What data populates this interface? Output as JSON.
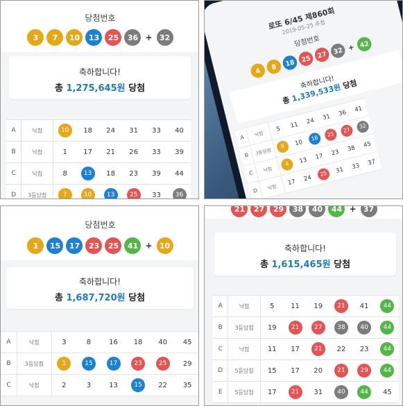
{
  "colors": {
    "yellow": "#e4a818",
    "blue": "#1c80d3",
    "red": "#e55353",
    "gray": "#7c7c7c",
    "green": "#53b746",
    "amount": "#1d7ac8"
  },
  "panel_tl": {
    "title": "당첨번호",
    "balls": [
      {
        "n": "3",
        "c": "yellow"
      },
      {
        "n": "7",
        "c": "yellow"
      },
      {
        "n": "10",
        "c": "yellow"
      },
      {
        "n": "13",
        "c": "blue"
      },
      {
        "n": "25",
        "c": "red"
      },
      {
        "n": "36",
        "c": "gray"
      }
    ],
    "plus": "+",
    "bonus": {
      "n": "32",
      "c": "gray"
    },
    "congrats": "축하합니다!",
    "prize_prefix": "총",
    "prize_amount": "1,275,645원",
    "prize_suffix": "당첨",
    "rows": [
      {
        "letter": "A",
        "rank": "낙첨",
        "nums": [
          {
            "n": "10",
            "c": "yellow"
          },
          {
            "n": "18"
          },
          {
            "n": "24"
          },
          {
            "n": "31"
          },
          {
            "n": "33"
          },
          {
            "n": "40"
          }
        ]
      },
      {
        "letter": "B",
        "rank": "낙첨",
        "nums": [
          {
            "n": "1"
          },
          {
            "n": "17"
          },
          {
            "n": "21"
          },
          {
            "n": "26"
          },
          {
            "n": "33"
          },
          {
            "n": "39"
          }
        ]
      },
      {
        "letter": "C",
        "rank": "낙첨",
        "nums": [
          {
            "n": "8"
          },
          {
            "n": "13",
            "c": "blue"
          },
          {
            "n": "18"
          },
          {
            "n": "23"
          },
          {
            "n": "39"
          },
          {
            "n": "44"
          }
        ]
      },
      {
        "letter": "D",
        "rank": "3등당첨",
        "nums": [
          {
            "n": "7",
            "c": "yellow"
          },
          {
            "n": "10",
            "c": "yellow"
          },
          {
            "n": "13",
            "c": "blue"
          },
          {
            "n": "25",
            "c": "red"
          },
          {
            "n": "33"
          },
          {
            "n": "36",
            "c": "gray"
          }
        ]
      }
    ]
  },
  "panel_tr": {
    "header": "로또 6/45 제860회",
    "date": "2019-05-25 추첨",
    "title": "당첨번호",
    "balls": [
      {
        "n": "4",
        "c": "yellow"
      },
      {
        "n": "8",
        "c": "yellow"
      },
      {
        "n": "18",
        "c": "blue"
      },
      {
        "n": "25",
        "c": "red"
      },
      {
        "n": "27",
        "c": "red"
      },
      {
        "n": "32",
        "c": "gray"
      }
    ],
    "plus": "+",
    "bonus": {
      "n": "42",
      "c": "green"
    },
    "congrats": "축하합니다!",
    "prize_prefix": "총",
    "prize_amount": "1,339,533원",
    "prize_suffix": "당첨",
    "rows": [
      {
        "letter": "A",
        "rank": "낙첨",
        "nums": [
          {
            "n": "5"
          },
          {
            "n": "11"
          },
          {
            "n": "24"
          },
          {
            "n": "31"
          },
          {
            "n": "36"
          },
          {
            "n": "41"
          }
        ]
      },
      {
        "letter": "B",
        "rank": "3등당첨",
        "nums": [
          {
            "n": "8",
            "c": "yellow"
          },
          {
            "n": "10"
          },
          {
            "n": "18",
            "c": "blue"
          },
          {
            "n": "25",
            "c": "red"
          },
          {
            "n": "27",
            "c": "red"
          },
          {
            "n": "32",
            "c": "gray"
          }
        ]
      },
      {
        "letter": "C",
        "rank": "낙첨",
        "nums": [
          {
            "n": "4",
            "c": "yellow"
          },
          {
            "n": "13"
          },
          {
            "n": "17"
          },
          {
            "n": "23"
          },
          {
            "n": "38"
          },
          {
            "n": "45"
          }
        ]
      },
      {
        "letter": "D",
        "rank": "낙첨",
        "nums": [
          {
            "n": "17"
          },
          {
            "n": "24"
          },
          {
            "n": "25",
            "c": "red"
          },
          {
            "n": "31"
          },
          {
            "n": "33"
          },
          {
            "n": "37"
          }
        ]
      }
    ]
  },
  "panel_bl": {
    "title": "당첨번호",
    "balls": [
      {
        "n": "1",
        "c": "yellow"
      },
      {
        "n": "15",
        "c": "blue"
      },
      {
        "n": "17",
        "c": "blue"
      },
      {
        "n": "23",
        "c": "red"
      },
      {
        "n": "25",
        "c": "red"
      },
      {
        "n": "41",
        "c": "green"
      }
    ],
    "plus": "+",
    "bonus": {
      "n": "10",
      "c": "yellow"
    },
    "congrats": "축하합니다!",
    "prize_prefix": "총",
    "prize_amount": "1,687,720원",
    "prize_suffix": "당첨",
    "rows": [
      {
        "letter": "A",
        "rank": "낙첨",
        "nums": [
          {
            "n": "3"
          },
          {
            "n": "8"
          },
          {
            "n": "16"
          },
          {
            "n": "18"
          },
          {
            "n": "40"
          },
          {
            "n": "45"
          }
        ]
      },
      {
        "letter": "B",
        "rank": "3등당첨",
        "nums": [
          {
            "n": "1",
            "c": "yellow"
          },
          {
            "n": "15",
            "c": "blue"
          },
          {
            "n": "17",
            "c": "blue"
          },
          {
            "n": "23",
            "c": "red"
          },
          {
            "n": "25",
            "c": "red"
          },
          {
            "n": "29"
          }
        ]
      },
      {
        "letter": "C",
        "rank": "낙첨",
        "nums": [
          {
            "n": "2"
          },
          {
            "n": "3"
          },
          {
            "n": "13"
          },
          {
            "n": "15",
            "c": "blue"
          },
          {
            "n": "22"
          },
          {
            "n": "35"
          }
        ]
      }
    ]
  },
  "panel_br": {
    "top_balls": [
      {
        "n": "21",
        "c": "red"
      },
      {
        "n": "27",
        "c": "red"
      },
      {
        "n": "29",
        "c": "red"
      },
      {
        "n": "38",
        "c": "gray"
      },
      {
        "n": "40",
        "c": "gray"
      },
      {
        "n": "44",
        "c": "green"
      }
    ],
    "plus": "+",
    "bonus": {
      "n": "37",
      "c": "gray"
    },
    "congrats": "축하합니다!",
    "prize_prefix": "총",
    "prize_amount": "1,615,465원",
    "prize_suffix": "당첨",
    "rows": [
      {
        "letter": "A",
        "rank": "낙첨",
        "nums": [
          {
            "n": "5"
          },
          {
            "n": "11"
          },
          {
            "n": "19"
          },
          {
            "n": "21",
            "c": "red"
          },
          {
            "n": "41"
          },
          {
            "n": "44",
            "c": "green"
          }
        ]
      },
      {
        "letter": "B",
        "rank": "3등당첨",
        "nums": [
          {
            "n": "19"
          },
          {
            "n": "21",
            "c": "red"
          },
          {
            "n": "27",
            "c": "red"
          },
          {
            "n": "38",
            "c": "gray"
          },
          {
            "n": "40",
            "c": "gray"
          },
          {
            "n": "44",
            "c": "green"
          }
        ]
      },
      {
        "letter": "C",
        "rank": "낙첨",
        "nums": [
          {
            "n": "11"
          },
          {
            "n": "17"
          },
          {
            "n": "21",
            "c": "red"
          },
          {
            "n": "22"
          },
          {
            "n": "23"
          },
          {
            "n": "44",
            "c": "green"
          }
        ]
      },
      {
        "letter": "D",
        "rank": "5등당첨",
        "nums": [
          {
            "n": "15"
          },
          {
            "n": "17"
          },
          {
            "n": "20"
          },
          {
            "n": "21",
            "c": "red"
          },
          {
            "n": "29",
            "c": "red"
          },
          {
            "n": "44",
            "c": "green"
          }
        ]
      },
      {
        "letter": "E",
        "rank": "5등당첨",
        "nums": [
          {
            "n": "17"
          },
          {
            "n": "21",
            "c": "red"
          },
          {
            "n": "31"
          },
          {
            "n": "40",
            "c": "gray"
          },
          {
            "n": "44",
            "c": "green"
          },
          {
            "n": "45"
          }
        ]
      }
    ]
  }
}
